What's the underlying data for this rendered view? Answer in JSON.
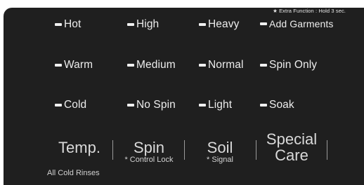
{
  "extra_function": "★ Extra Function : Hold 3 sec.",
  "columns": [
    {
      "options": [
        "Hot",
        "Warm",
        "Cold"
      ],
      "heading": "Temp.",
      "sub": ""
    },
    {
      "options": [
        "High",
        "Medium",
        "No Spin"
      ],
      "heading": "Spin",
      "sub": "* Control Lock"
    },
    {
      "options": [
        "Heavy",
        "Normal",
        "Light"
      ],
      "heading": "Soil",
      "sub": "* Signal"
    },
    {
      "options": [
        "Add Garments",
        "Spin Only",
        "Soak"
      ],
      "heading_lines": [
        "Special",
        "Care"
      ]
    }
  ],
  "footer": "All Cold Rinses"
}
